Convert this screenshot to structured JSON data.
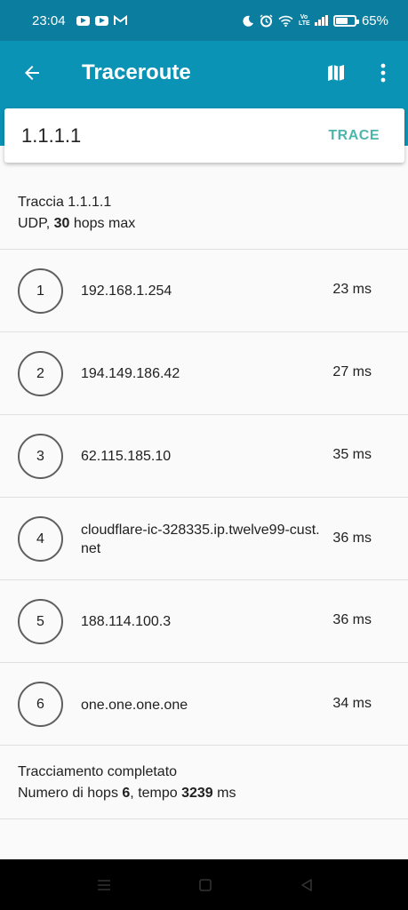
{
  "status_bar": {
    "time": "23:04",
    "battery": "65%",
    "battery_level": 0.65,
    "notification_icons": [
      "youtube-icon",
      "youtube-icon",
      "gmail-icon"
    ],
    "system_icons": [
      "moon-icon",
      "alarm-icon",
      "wifi-icon",
      "volte-icon",
      "signal-icon",
      "battery-icon"
    ],
    "volte_label": "Vo LTE"
  },
  "app_bar": {
    "title": "Traceroute",
    "back_icon": "arrow-back-icon",
    "map_icon": "map-icon",
    "more_icon": "more-vert-icon"
  },
  "search": {
    "value": "1.1.1.1",
    "button_label": "TRACE"
  },
  "trace_header": {
    "title": "Traccia 1.1.1.1",
    "protocol": "UDP, ",
    "max_hops": "30",
    "max_hops_suffix": " hops max"
  },
  "hops": [
    {
      "number": "1",
      "host": "192.168.1.254",
      "time": "23 ms"
    },
    {
      "number": "2",
      "host": "194.149.186.42",
      "time": "27 ms"
    },
    {
      "number": "3",
      "host": "62.115.185.10",
      "time": "35 ms"
    },
    {
      "number": "4",
      "host": "cloudflare-ic-328335.ip.twelve99-cust.net",
      "time": "36 ms"
    },
    {
      "number": "5",
      "host": "188.114.100.3",
      "time": "36 ms"
    },
    {
      "number": "6",
      "host": "one.one.one.one",
      "time": "34 ms"
    }
  ],
  "summary": {
    "title": "Tracciamento completato",
    "hops_prefix": "Numero di hops ",
    "hops_count": "6",
    "time_prefix": ", tempo ",
    "time_value": "3239",
    "time_suffix": " ms"
  },
  "colors": {
    "status_bar": "#0b7ea0",
    "app_bar": "#0b93b5",
    "accent": "#4db6ac",
    "background": "#fafafa"
  }
}
